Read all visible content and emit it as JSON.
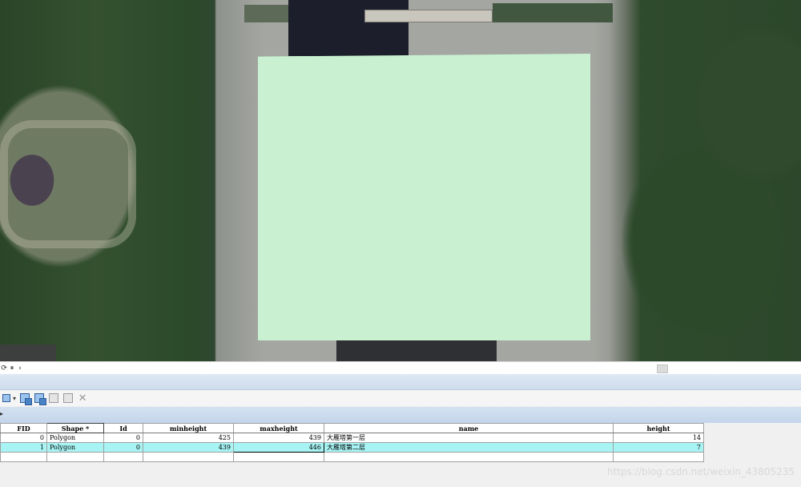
{
  "map": {
    "layer_feature": "polygon",
    "polygon_color": "#c8f0d1"
  },
  "scrollbar": {
    "controls": [
      "⟳",
      "⏸",
      "‹"
    ]
  },
  "toolbar": {
    "icons": [
      "table-options-icon",
      "select-by-attributes-icon",
      "switch-selection-icon",
      "clear-selection-icon",
      "zoom-to-selected-icon",
      "delete-selected-icon"
    ]
  },
  "table": {
    "columns": [
      {
        "key": "FID",
        "label": "FID"
      },
      {
        "key": "Shape",
        "label": "Shape *"
      },
      {
        "key": "Id",
        "label": "Id"
      },
      {
        "key": "minheight",
        "label": "minheight"
      },
      {
        "key": "maxheight",
        "label": "maxheight"
      },
      {
        "key": "name",
        "label": "name"
      },
      {
        "key": "height",
        "label": "height"
      }
    ],
    "rows": [
      {
        "FID": "0",
        "Shape": "Polygon",
        "Id": "0",
        "minheight": "425",
        "maxheight": "439",
        "name": "大雁塔第一层",
        "height": "14"
      },
      {
        "FID": "1",
        "Shape": "Polygon",
        "Id": "0",
        "minheight": "439",
        "maxheight": "446",
        "name": "大雁塔第二层",
        "height": "7"
      }
    ]
  },
  "watermark": "https://blog.csdn.net/weixin_43805235"
}
